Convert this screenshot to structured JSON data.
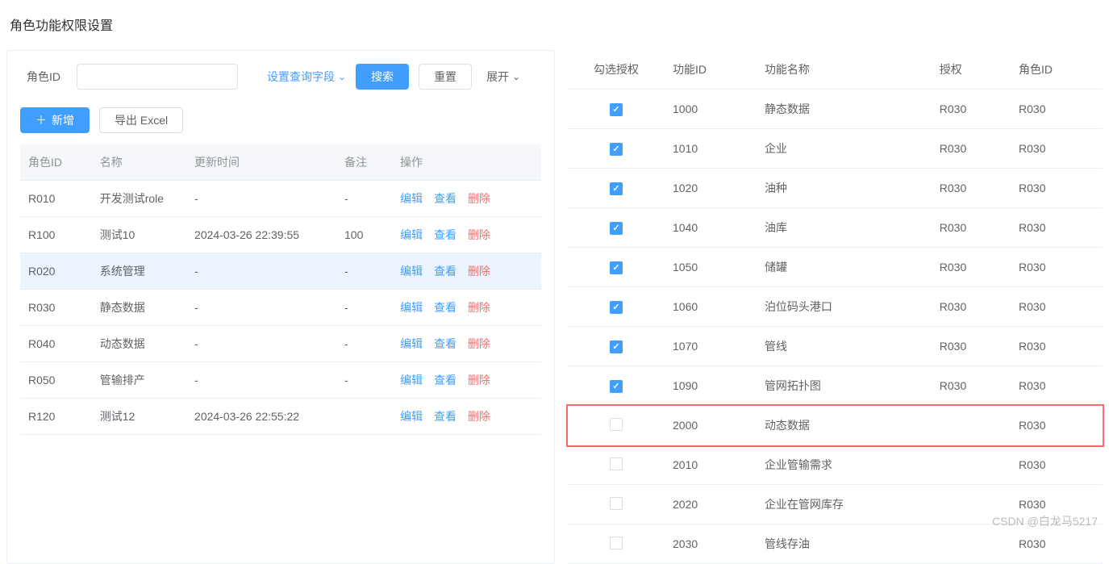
{
  "pageTitle": "角色功能权限设置",
  "searchBar": {
    "roleIdLabel": "角色ID",
    "configFieldsLabel": "设置查询字段",
    "searchBtn": "搜索",
    "resetBtn": "重置",
    "expandBtn": "展开"
  },
  "toolbar": {
    "addBtn": "新增",
    "exportBtn": "导出 Excel"
  },
  "leftTable": {
    "headers": {
      "roleId": "角色ID",
      "name": "名称",
      "updateTime": "更新时间",
      "remark": "备注",
      "actions": "操作"
    },
    "actionLabels": {
      "edit": "编辑",
      "view": "查看",
      "delete": "删除"
    },
    "rows": [
      {
        "roleId": "R010",
        "name": "开发测试role",
        "updateTime": "-",
        "remark": "-",
        "selected": false
      },
      {
        "roleId": "R100",
        "name": "测试10",
        "updateTime": "2024-03-26 22:39:55",
        "remark": "100",
        "selected": false
      },
      {
        "roleId": "R020",
        "name": "系统管理",
        "updateTime": "-",
        "remark": "-",
        "selected": true
      },
      {
        "roleId": "R030",
        "name": "静态数据",
        "updateTime": "-",
        "remark": "-",
        "selected": false
      },
      {
        "roleId": "R040",
        "name": "动态数据",
        "updateTime": "-",
        "remark": "-",
        "selected": false
      },
      {
        "roleId": "R050",
        "name": "管输排产",
        "updateTime": "-",
        "remark": "-",
        "selected": false
      },
      {
        "roleId": "R120",
        "name": "测试12",
        "updateTime": "2024-03-26 22:55:22",
        "remark": "",
        "selected": false
      }
    ]
  },
  "rightTable": {
    "headers": {
      "check": "勾选授权",
      "funcId": "功能ID",
      "funcName": "功能名称",
      "auth": "授权",
      "roleId": "角色ID"
    },
    "rows": [
      {
        "checked": true,
        "funcId": "1000",
        "funcName": "静态数据",
        "auth": "R030",
        "roleId": "R030",
        "highlight": false
      },
      {
        "checked": true,
        "funcId": "1010",
        "funcName": "企业",
        "auth": "R030",
        "roleId": "R030",
        "highlight": false
      },
      {
        "checked": true,
        "funcId": "1020",
        "funcName": "油种",
        "auth": "R030",
        "roleId": "R030",
        "highlight": false
      },
      {
        "checked": true,
        "funcId": "1040",
        "funcName": "油库",
        "auth": "R030",
        "roleId": "R030",
        "highlight": false
      },
      {
        "checked": true,
        "funcId": "1050",
        "funcName": "储罐",
        "auth": "R030",
        "roleId": "R030",
        "highlight": false
      },
      {
        "checked": true,
        "funcId": "1060",
        "funcName": "泊位码头港口",
        "auth": "R030",
        "roleId": "R030",
        "highlight": false
      },
      {
        "checked": true,
        "funcId": "1070",
        "funcName": "管线",
        "auth": "R030",
        "roleId": "R030",
        "highlight": false
      },
      {
        "checked": true,
        "funcId": "1090",
        "funcName": "管网拓扑图",
        "auth": "R030",
        "roleId": "R030",
        "highlight": false
      },
      {
        "checked": false,
        "funcId": "2000",
        "funcName": "动态数据",
        "auth": "",
        "roleId": "R030",
        "highlight": true
      },
      {
        "checked": false,
        "funcId": "2010",
        "funcName": "企业管输需求",
        "auth": "",
        "roleId": "R030",
        "highlight": false
      },
      {
        "checked": false,
        "funcId": "2020",
        "funcName": "企业在管网库存",
        "auth": "",
        "roleId": "R030",
        "highlight": false
      },
      {
        "checked": false,
        "funcId": "2030",
        "funcName": "管线存油",
        "auth": "",
        "roleId": "R030",
        "highlight": false
      }
    ]
  },
  "watermark": "CSDN @白龙马5217"
}
